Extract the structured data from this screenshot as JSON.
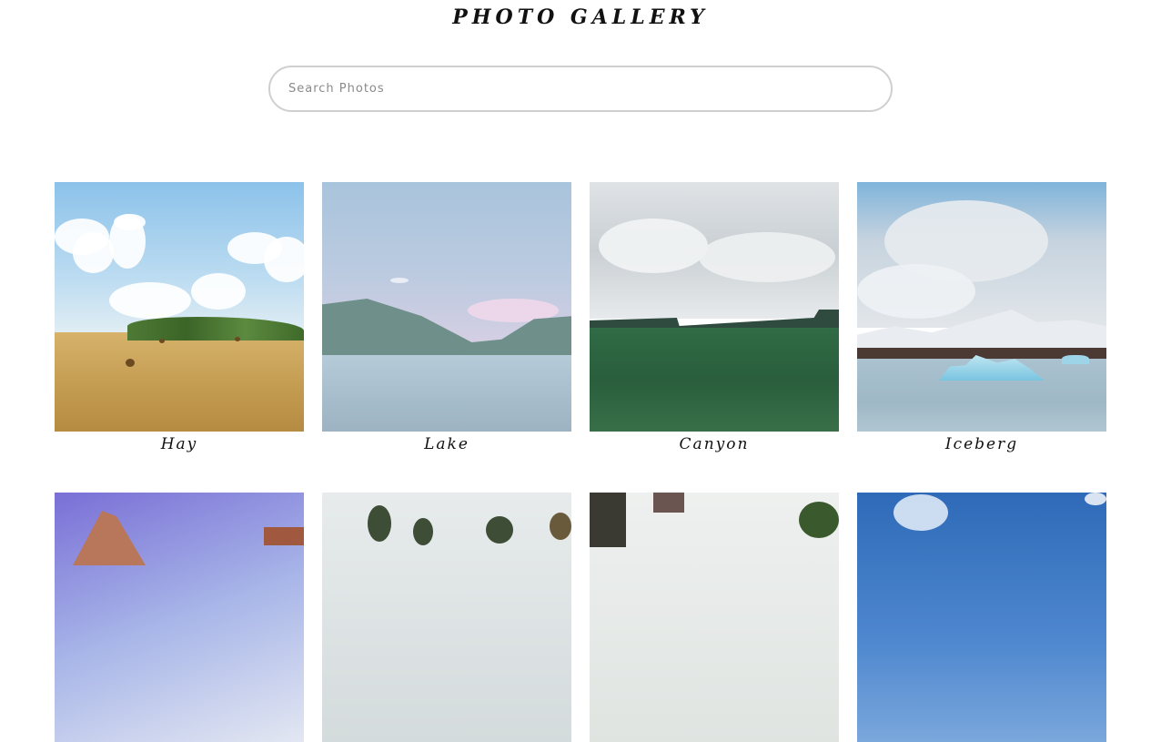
{
  "header": {
    "title": "PHOTO GALLERY"
  },
  "search": {
    "placeholder": "Search Photos",
    "value": ""
  },
  "photos": [
    {
      "caption": "Hay",
      "icon": "hay-field-photo"
    },
    {
      "caption": "Lake",
      "icon": "lake-photo"
    },
    {
      "caption": "Canyon",
      "icon": "canyon-photo"
    },
    {
      "caption": "Iceberg",
      "icon": "iceberg-photo"
    },
    {
      "caption": "",
      "icon": "mountain-photo"
    },
    {
      "caption": "",
      "icon": "trees-photo"
    },
    {
      "caption": "",
      "icon": "forest-photo"
    },
    {
      "caption": "",
      "icon": "blue-sky-photo"
    }
  ],
  "colors": {
    "background": "#ffffff",
    "title": "#111111",
    "search_border": "#cfcfcf"
  }
}
